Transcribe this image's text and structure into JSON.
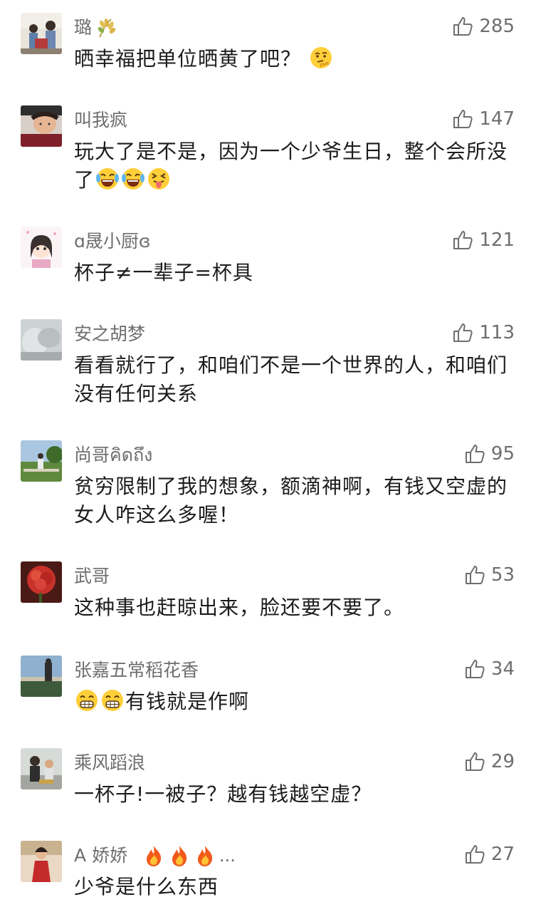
{
  "comments": [
    {
      "username": "璐",
      "text": "晒幸福把单位晒黄了吧？",
      "likes": "285",
      "badge": "rice-ear-icon",
      "emojis": [
        "hmm-emoji"
      ]
    },
    {
      "username": "叫我疯",
      "text": "玩大了是不是，因为一个少爷生日，整个会所没了",
      "likes": "147",
      "emojis": [
        "laugh-cry-emoji",
        "laugh-cry-emoji",
        "tongue-squint-emoji"
      ]
    },
    {
      "username": "ɑ晟小厨ɞ",
      "text": "杯子≠一辈子=杯具",
      "likes": "121"
    },
    {
      "username": "安之胡梦",
      "text": "看看就行了，和咱们不是一个世界的人，和咱们没有任何关系",
      "likes": "113"
    },
    {
      "username": "尚哥คิดถึง",
      "text": "贫穷限制了我的想象，额滴神啊，有钱又空虚的女人咋这么多喔！",
      "likes": "95"
    },
    {
      "username": "武哥",
      "text": "这种事也赶晾出来，脸还要不要了。",
      "likes": "53"
    },
    {
      "username": "张嘉五常稻花香",
      "text": "有钱就是作啊",
      "likes": "34",
      "leading_emojis": [
        "grin-emoji",
        "grin-emoji"
      ]
    },
    {
      "username": "乘风蹈浪",
      "text": "一杯子!一被子？越有钱越空虚？",
      "likes": "29"
    },
    {
      "username": "A 娇娇",
      "suffix": "...",
      "text": "少爷是什么东西",
      "likes": "27",
      "badges": [
        "fire-icon",
        "fire-icon",
        "fire-icon"
      ]
    }
  ],
  "colors": {
    "username": "#6e6e6e",
    "text": "#1c1c1c",
    "like": "#6e6e6e",
    "background": "#ffffff"
  }
}
